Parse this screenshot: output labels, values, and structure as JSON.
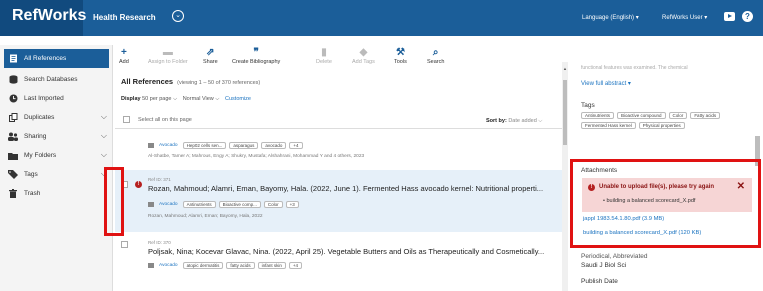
{
  "topbar": {
    "logo": "RefWorks",
    "project": "Health Research",
    "language": "Language (English) ▾",
    "user": "RefWorks User ▾"
  },
  "sidebar": {
    "items": [
      {
        "label": "All References",
        "icon": "references-icon",
        "chev": ""
      },
      {
        "label": "Search Databases",
        "icon": "database-icon",
        "chev": ""
      },
      {
        "label": "Last Imported",
        "icon": "clock-icon",
        "chev": ""
      },
      {
        "label": "Duplicates",
        "icon": "duplicates-icon",
        "chev": "⌵"
      },
      {
        "label": "Sharing",
        "icon": "users-icon",
        "chev": "⌵"
      },
      {
        "label": "My Folders",
        "icon": "folder-icon",
        "chev": "⌵"
      },
      {
        "label": "Tags",
        "icon": "tag-icon",
        "chev": "⌵"
      },
      {
        "label": "Trash",
        "icon": "trash-icon",
        "chev": ""
      }
    ]
  },
  "toolbar": {
    "add": "Add",
    "assign": "Assign to Folder",
    "share": "Share",
    "bib": "Create Bibliography",
    "delete": "Delete",
    "addtags": "Add Tags",
    "tools": "Tools",
    "search": "Search"
  },
  "main": {
    "title": "All References",
    "count": "(viewing 1 – 50 of 370 references)",
    "display_label": "Display",
    "per_page": "50 per page ⌵",
    "view": "Normal View ⌵",
    "customize": "Customize",
    "select_all": "Select all on this page",
    "sort_label": "Sort by:",
    "sort_value": "Date added ⌵"
  },
  "refs": [
    {
      "id": "",
      "title": "",
      "folder": "Avocado",
      "tags": [
        "Hep02 cells sen...",
        "asparagus",
        "avocado",
        "+4"
      ],
      "authors": "Al-Shatbe, Tamer A; Mahrous, Engy A; Shukry, Mustafa; Alshahrani, Mohammad Y and 4 others, 2023"
    },
    {
      "id": "Ref ID: 371",
      "title": "Rozan, Mahmoud; Alamri, Eman, Bayomy, Hala. (2022, June 1). Fermented Hass avocado kernel: Nutritional properti...",
      "folder": "Avocado",
      "tags": [
        "Antinutrients",
        "Bioactive comp...",
        "Color",
        "+3"
      ],
      "authors": "Rozan, Mahmoud; Alamri, Eman; Bayomy, Hala, 2022"
    },
    {
      "id": "Ref ID: 370",
      "title": "Poljsak, Nina; Kocevar Glavac, Nina. (2022, April 25). Vegetable Butters and Oils as Therapeutically and Cosmetically...",
      "folder": "Avocado",
      "tags": [
        "atopic dermatitis",
        "fatty acids",
        "infant skin",
        "+4"
      ],
      "authors": ""
    }
  ],
  "panel": {
    "faded_text": "functional features was examined. The chemical",
    "view_abstract": "View full abstract ▾",
    "tags_heading": "Tags",
    "tags": [
      "Antinutrients",
      "Bioactive compound",
      "Color",
      "Fatty acids",
      "Fermented Hass kernel",
      "Physical properties"
    ],
    "attachments_heading": "Attachments",
    "error_message": "Unable to upload file(s), please try again",
    "error_file": "• building a balanced scorecard_X.pdf",
    "files": [
      "jappl 1983.54.1.80.pdf (3.9 MB)",
      "building a balanced scorecard_X.pdf (120 KB)"
    ],
    "periodical_label": "Periodical, Abbreviated",
    "periodical_value": "Saudi J Biol Sci",
    "publish_label": "Publish Date"
  }
}
